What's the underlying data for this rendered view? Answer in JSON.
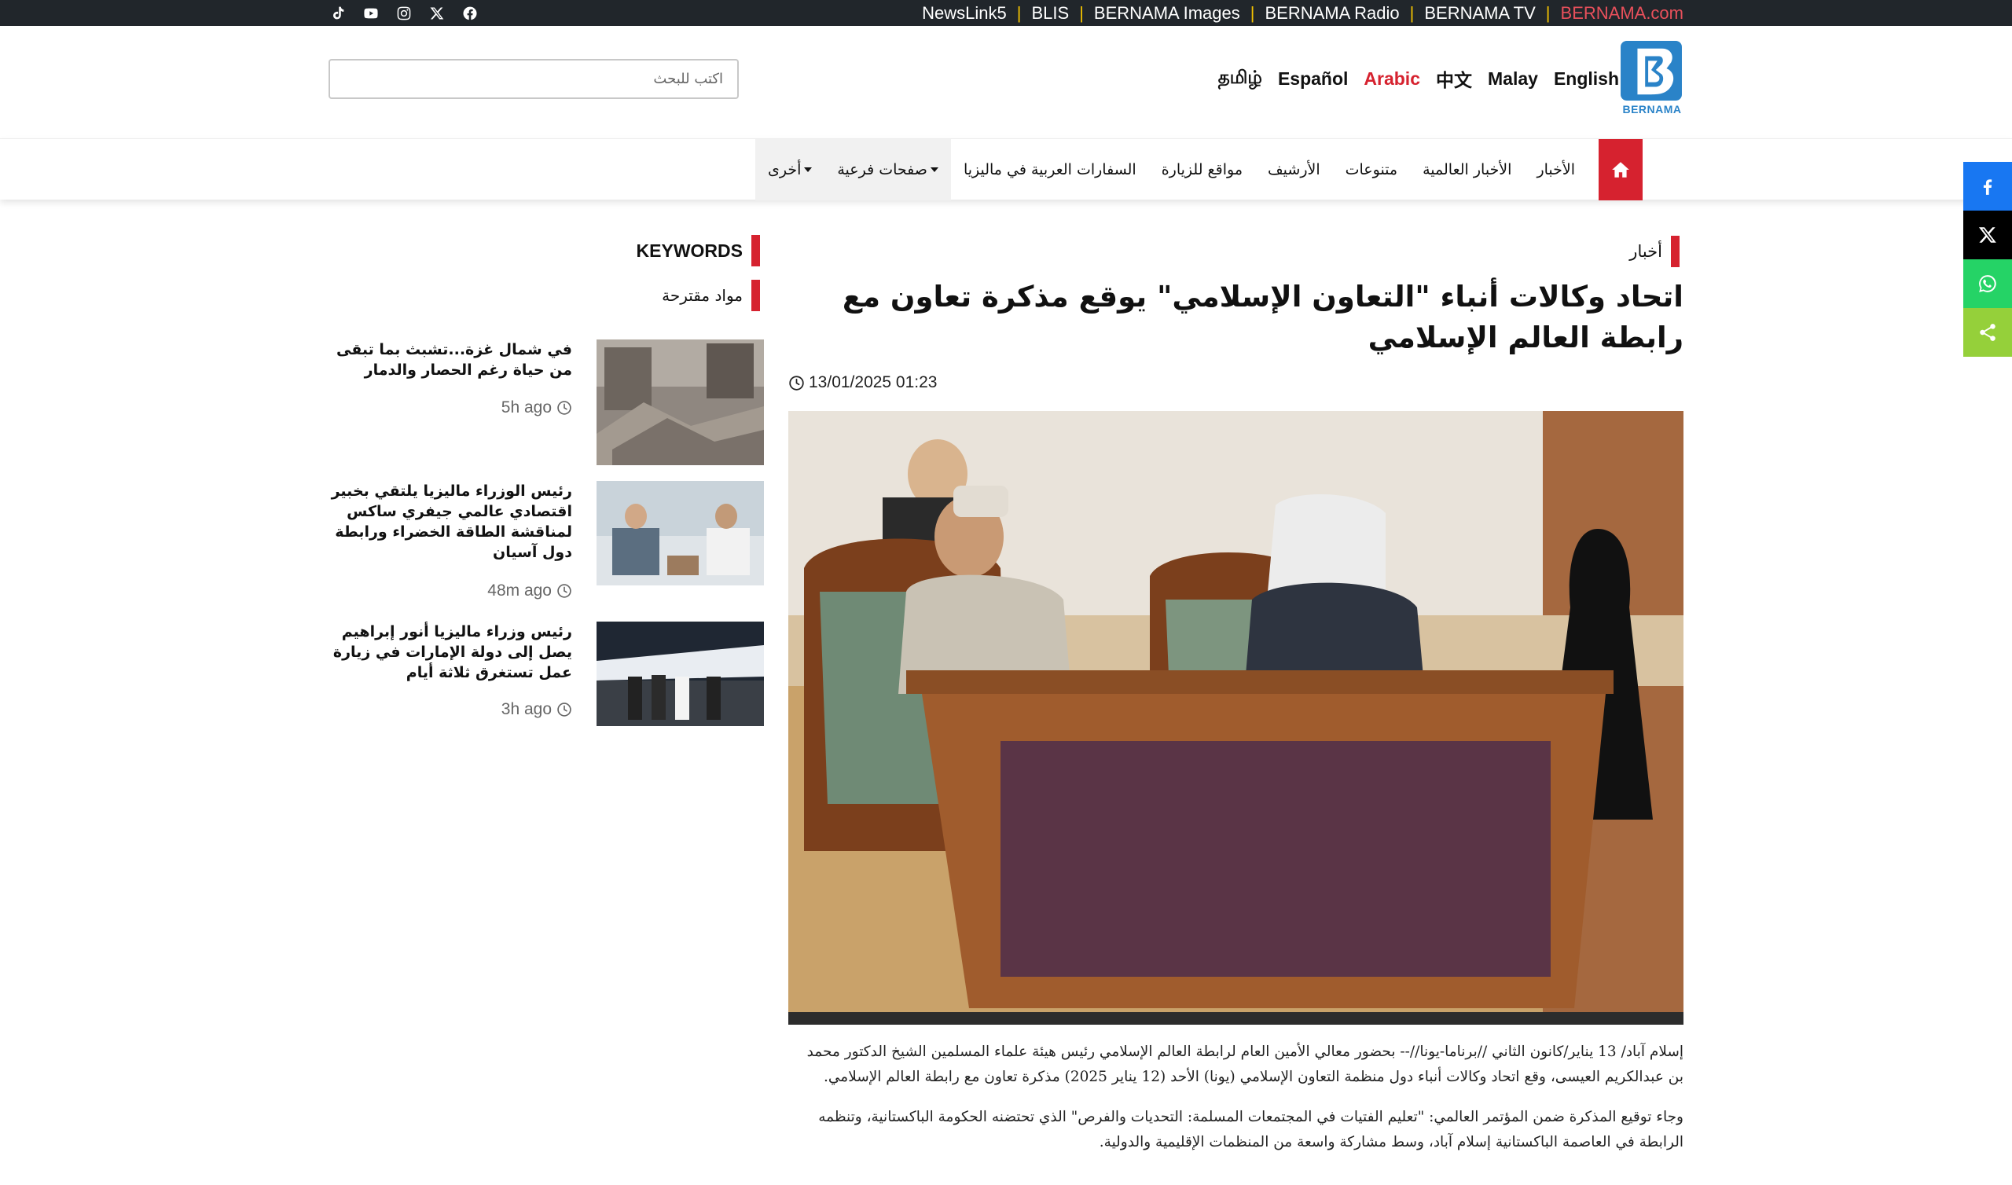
{
  "topbar": {
    "social_icons": [
      "tiktok-icon",
      "youtube-icon",
      "instagram-icon",
      "x-icon",
      "facebook-icon"
    ],
    "links": [
      "NewsLink5",
      "BLIS",
      "BERNAMA Images",
      "BERNAMA Radio",
      "BERNAMA TV",
      "BERNAMA.com"
    ],
    "separator": "|",
    "accent_color": "#e8505b"
  },
  "header": {
    "search_placeholder": "اكتب للبحث",
    "languages": [
      "தமிழ்",
      "Español",
      "Arabic",
      "中文",
      "Malay",
      "English"
    ],
    "active_language": "Arabic",
    "logo_text": "BERNAMA",
    "brand_color": "#d6222f"
  },
  "nav": {
    "home_icon": "home-icon",
    "items": [
      "الأخبار",
      "الأخبار العالمية",
      "متنوعات",
      "الأرشيف",
      "مواقع للزيارة",
      "السفارات العربية في ماليزيا",
      "صفحات فرعية",
      "أخرى"
    ]
  },
  "share": {
    "icons": [
      "facebook-icon",
      "x-icon",
      "whatsapp-icon",
      "share-icon"
    ]
  },
  "article": {
    "section": "أخبار",
    "title": "اتحاد وكالات أنباء \"التعاون الإسلامي\" يوقع مذكرة تعاون مع رابطة العالم الإسلامي",
    "date": "13/01/2025 01:23",
    "paragraphs": [
      "إسلام آباد/ 13 يناير/كانون الثاني //برناما-يونا//-- بحضور معالي الأمين العام لرابطة العالم الإسلامي رئيس هيئة علماء المسلمين الشيخ الدكتور محمد بن عبدالكريم العيسى، وقع اتحاد وكالات أنباء دول منظمة التعاون الإسلامي (يونا) الأحد (12 يناير 2025) مذكرة تعاون مع رابطة العالم الإسلامي.",
      "وجاء توقيع المذكرة ضمن المؤتمر العالمي: \"تعليم الفتيات في المجتمعات المسلمة: التحديات والفرص\" الذي تحتضنه الحكومة الباكستانية، وتنظمه الرابطة في العاصمة الباكستانية إسلام آباد، وسط مشاركة واسعة من المنظمات الإقليمية والدولية.",
      ""
    ]
  },
  "sidebar": {
    "keywords_label": "KEYWORDS",
    "suggested_label": "مواد مقترحة",
    "items": [
      {
        "title": "في شمال غزة...تشبث بما تبقى من حياة رغم الحصار والدمار",
        "time": "5h ago"
      },
      {
        "title": "رئيس الوزراء ماليزيا يلتقي بخبير اقتصادي عالمي جيفري ساكس لمناقشة الطاقة الخضراء ورابطة دول آسيان",
        "time": "48m ago"
      },
      {
        "title": "رئيس وزراء ماليزيا أنور إبراهيم يصل إلى دولة الإمارات في زيارة عمل تستغرق ثلاثة أيام",
        "time": "3h ago"
      }
    ]
  }
}
